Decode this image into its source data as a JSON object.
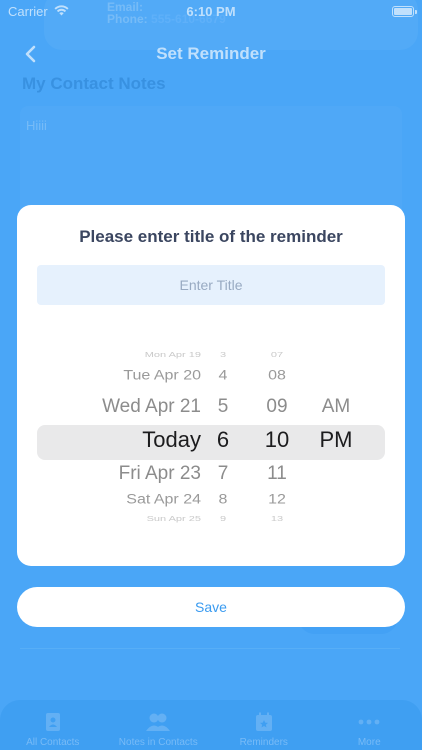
{
  "status_bar": {
    "carrier": "Carrier",
    "time": "6:10 PM"
  },
  "background": {
    "email_label": "Email:",
    "phone_label": "Phone:",
    "phone_value": "555-610-6679",
    "nav_title": "Set Reminder",
    "section_title": "My Contact Notes",
    "note_text": "Hiiii"
  },
  "modal": {
    "title": "Please enter title of the reminder",
    "title_input": {
      "placeholder": "Enter Title",
      "value": ""
    },
    "picker": {
      "dates": [
        "Mon Apr 19",
        "Tue Apr 20",
        "Wed Apr 21",
        "Today",
        "Fri Apr 23",
        "Sat Apr 24",
        "Sun Apr 25"
      ],
      "hours": [
        "3",
        "4",
        "5",
        "6",
        "7",
        "8",
        "9"
      ],
      "minutes": [
        "07",
        "08",
        "09",
        "10",
        "11",
        "12",
        "13"
      ],
      "ampm": [
        "",
        "",
        "AM",
        "PM",
        "",
        "",
        ""
      ],
      "selected": {
        "date": "Today",
        "hour": "6",
        "minute": "10",
        "ampm": "PM"
      }
    },
    "save_label": "Save"
  },
  "tab_bar": {
    "items": [
      {
        "label": "All Contacts",
        "icon": "contact-book-icon"
      },
      {
        "label": "Notes in Contacts",
        "icon": "people-icon"
      },
      {
        "label": "Reminders",
        "icon": "calendar-icon"
      },
      {
        "label": "More",
        "icon": "more-dots-icon"
      }
    ]
  },
  "colors": {
    "background": "#4aa6f7",
    "accent": "#3a9bf0",
    "title_text": "#3b4660",
    "input_bg": "#e6f1fd"
  }
}
